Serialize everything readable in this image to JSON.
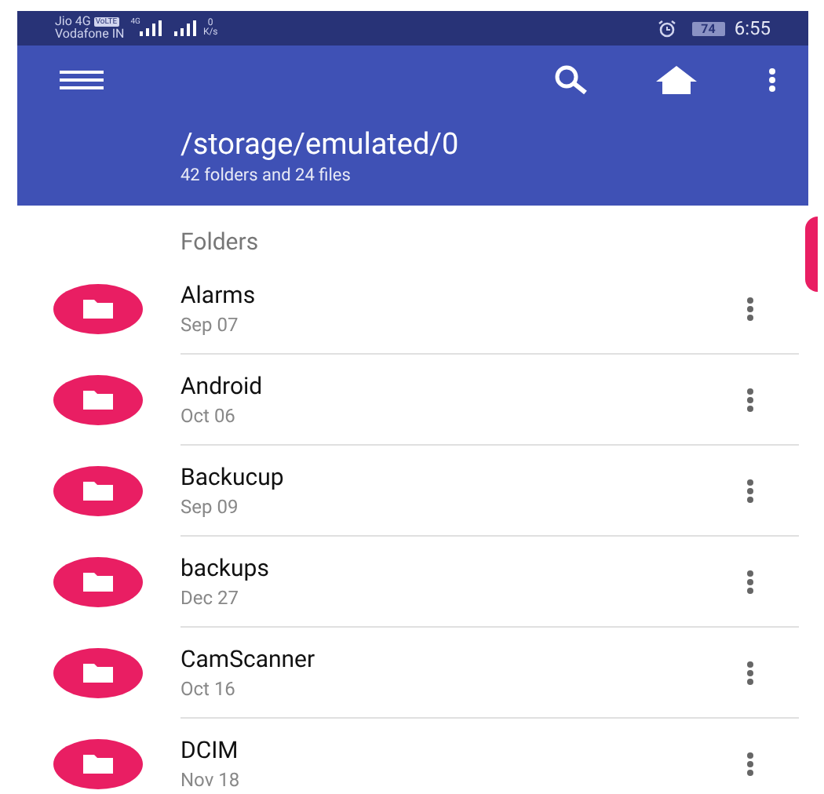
{
  "status_bar": {
    "carrier_1": "Jio 4G",
    "volte_badge": "VoLTE",
    "carrier_2": "Vodafone IN",
    "network_type": "4G",
    "speed_value": "0",
    "speed_unit": "K/s",
    "battery": "74",
    "time": "6:55"
  },
  "app_bar": {
    "path": "/storage/emulated/0",
    "summary": "42 folders and 24 files"
  },
  "section_header": "Folders",
  "folders": [
    {
      "name": "Alarms",
      "date": "Sep 07"
    },
    {
      "name": "Android",
      "date": "Oct 06"
    },
    {
      "name": "Backucup",
      "date": "Sep 09"
    },
    {
      "name": "backups",
      "date": "Dec 27"
    },
    {
      "name": "CamScanner",
      "date": "Oct 16"
    },
    {
      "name": "DCIM",
      "date": "Nov 18"
    }
  ]
}
